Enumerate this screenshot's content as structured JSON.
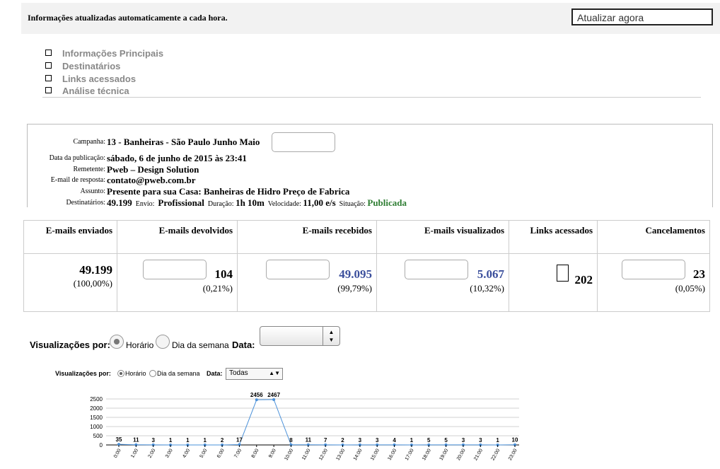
{
  "top": {
    "notice": "Informações atualizadas automaticamente a cada hora.",
    "refresh_button": "Atualizar agora"
  },
  "nav": {
    "items": [
      {
        "label": "Informações Principais"
      },
      {
        "label": "Destinatários"
      },
      {
        "label": "Links acessados"
      },
      {
        "label": "Análise técnica"
      }
    ]
  },
  "campaign": {
    "campaign_label": "Campanha:",
    "campaign_value": "13 - Banheiras - São Paulo Junho Maio",
    "date_label": "Data da publicação:",
    "date_value": "sábado, 6 de junho de 2015 às 23:41",
    "sender_label": "Remetente:",
    "sender_value": "Pweb – Design Solution",
    "reply_label": "E-mail de resposta:",
    "reply_value": "contato@pweb.com.br",
    "subject_label": "Assunto:",
    "subject_value": "Presente para sua Casa: Banheiras de Hidro Preço de Fabrica",
    "recipients_label": "Destinatários:",
    "recipients_value": "49.199",
    "send_label": "Envio:",
    "send_value": "Profissional",
    "duration_label": "Duração:",
    "duration_value": "1h 10m",
    "speed_label": "Velocidade:",
    "speed_value": "11,00 e/s",
    "status_label": "Situação:",
    "status_value": "Publicada"
  },
  "stats": {
    "columns": [
      {
        "header": "E-mails enviados",
        "value": "49.199",
        "pct": "(100,00%)"
      },
      {
        "header": "E-mails devolvidos",
        "value": "104",
        "pct": "(0,21%)"
      },
      {
        "header": "E-mails recebidos",
        "value": "49.095",
        "pct": "(99,79%)"
      },
      {
        "header": "E-mails visualizados",
        "value": "5.067",
        "pct": "(10,32%)"
      },
      {
        "header": "Links acessados",
        "value": "202",
        "pct": ""
      },
      {
        "header": "Cancelamentos",
        "value": "23",
        "pct": "(0,05%)"
      }
    ]
  },
  "view_controls": {
    "label": "Visualizações por:",
    "option_hour": "Horário",
    "option_weekday": "Dia da semana",
    "date_label": "Data:",
    "selected_date": "Todas"
  },
  "chart_data": {
    "type": "line",
    "categories": [
      "0:00",
      "1:00",
      "2:00",
      "3:00",
      "4:00",
      "5:00",
      "6:00",
      "7:00",
      "8:00",
      "9:00",
      "10:00",
      "11:00",
      "12:00",
      "13:00",
      "14:00",
      "15:00",
      "16:00",
      "17:00",
      "18:00",
      "19:00",
      "20:00",
      "21:00",
      "22:00",
      "23:00"
    ],
    "values": [
      35,
      11,
      3,
      1,
      1,
      1,
      2,
      17,
      2456,
      2467,
      8,
      11,
      7,
      2,
      3,
      3,
      4,
      1,
      5,
      5,
      3,
      3,
      1,
      10
    ],
    "yticks": [
      0,
      500,
      1000,
      1500,
      2000,
      2500
    ],
    "ylim": [
      0,
      2500
    ],
    "grid": true,
    "title": "",
    "xlabel": "",
    "ylabel": "",
    "color": "#4a90d9"
  }
}
